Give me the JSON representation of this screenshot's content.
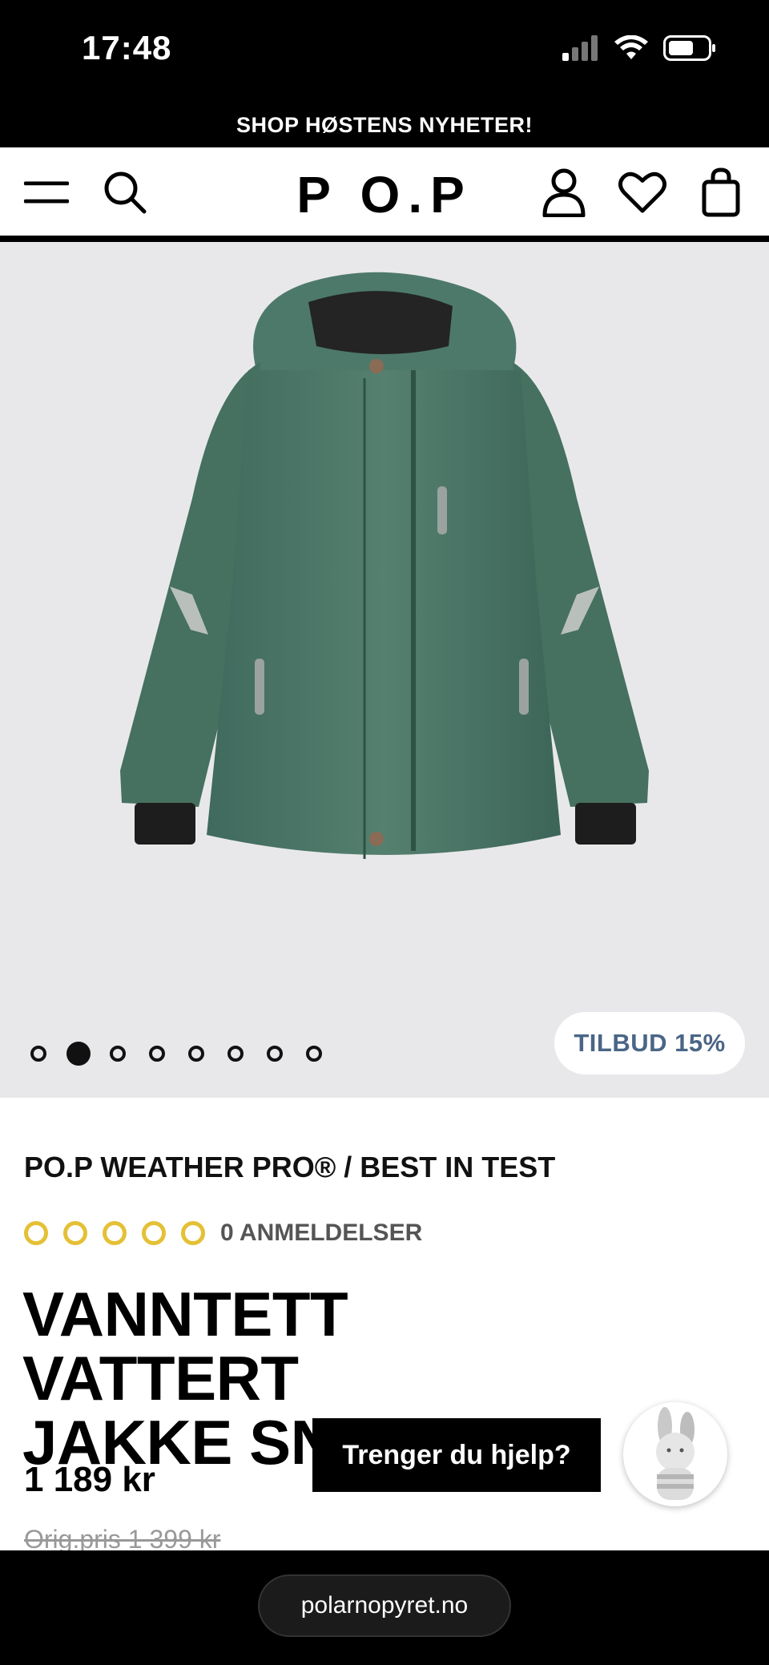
{
  "status_bar": {
    "time": "17:48"
  },
  "promo": {
    "text": "SHOP HØSTENS NYHETER!"
  },
  "header": {
    "logo": "P O.P"
  },
  "gallery": {
    "dots_count": 8,
    "active_index": 1,
    "badge": "TILBUD 15%"
  },
  "product": {
    "series": "PO.P WEATHER PRO® / BEST IN TEST",
    "rating_value": 0,
    "rating_max": 5,
    "reviews": "0 ANMELDELSER",
    "title_line1": "VANNTETT VATTERT",
    "title_line2": "JAKKE SNOWY",
    "price": "1 189 kr",
    "orig_price": "Orig.pris 1 399 kr"
  },
  "help": {
    "label": "Trenger du hjelp?"
  },
  "browser": {
    "url": "polarnopyret.no"
  },
  "colors": {
    "accent_star": "#e4c035",
    "badge_text": "#4a6586",
    "jacket": "#4f7a6d"
  }
}
